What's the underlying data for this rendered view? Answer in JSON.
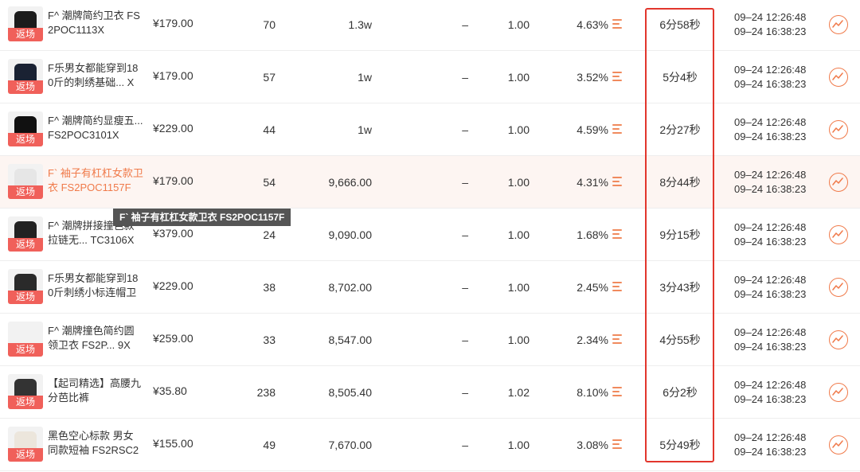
{
  "tooltip": "F` 袖子有杠杠女款卫衣 FS2POC1157F",
  "rows": [
    {
      "tag": "返场",
      "name": "F^ 潮牌简约卫衣 FS2POC1113X",
      "price": "¥179.00",
      "c1": "70",
      "c2": "1.3w",
      "c3": "–",
      "c4": "1.00",
      "c5": "4.63%",
      "duration": "6分58秒",
      "time1": "09–24  12:26:48",
      "time2": "09–24  16:38:23",
      "shirt": "#1c1c1c"
    },
    {
      "tag": "返场",
      "name": "F乐男女都能穿到180斤的刺绣基础... X",
      "price": "¥179.00",
      "c1": "57",
      "c2": "1w",
      "c3": "–",
      "c4": "1.00",
      "c5": "3.52%",
      "duration": "5分4秒",
      "time1": "09–24  12:26:48",
      "time2": "09–24  16:38:23",
      "shirt": "#1a2233"
    },
    {
      "tag": "返场",
      "name": "F^ 潮牌简约显瘦五... FS2POC3101X",
      "price": "¥229.00",
      "c1": "44",
      "c2": "1w",
      "c3": "–",
      "c4": "1.00",
      "c5": "4.59%",
      "duration": "2分27秒",
      "time1": "09–24  12:26:48",
      "time2": "09–24  16:38:23",
      "shirt": "#111111"
    },
    {
      "tag": "返场",
      "name": "F` 袖子有杠杠女款卫衣 FS2POC1157F",
      "price": "¥179.00",
      "c1": "54",
      "c2": "9,666.00",
      "c3": "–",
      "c4": "1.00",
      "c5": "4.31%",
      "duration": "8分44秒",
      "time1": "09–24  12:26:48",
      "time2": "09–24  16:38:23",
      "shirt": "#e6e6e6"
    },
    {
      "tag": "返场",
      "name": "F^ 潮牌拼接撞色款拉链无... TC3106X",
      "price": "¥379.00",
      "c1": "24",
      "c2": "9,090.00",
      "c3": "–",
      "c4": "1.00",
      "c5": "1.68%",
      "duration": "9分15秒",
      "time1": "09–24  12:26:48",
      "time2": "09–24  16:38:23",
      "shirt": "#222222"
    },
    {
      "tag": "返场",
      "name": "F乐男女都能穿到180斤刺绣小标连帽卫",
      "price": "¥229.00",
      "c1": "38",
      "c2": "8,702.00",
      "c3": "–",
      "c4": "1.00",
      "c5": "2.45%",
      "duration": "3分43秒",
      "time1": "09–24  12:26:48",
      "time2": "09–24  16:38:23",
      "shirt": "#2a2a2a"
    },
    {
      "tag": "返场",
      "name": "F^ 潮牌撞色简约圆领卫衣 FS2P... 9X",
      "price": "¥259.00",
      "c1": "33",
      "c2": "8,547.00",
      "c3": "–",
      "c4": "1.00",
      "c5": "2.34%",
      "duration": "4分55秒",
      "time1": "09–24  12:26:48",
      "time2": "09–24  16:38:23",
      "shirt": "#f2f2f2"
    },
    {
      "tag": "返场",
      "name": "【起司精选】高腰九分芭比裤",
      "price": "¥35.80",
      "c1": "238",
      "c2": "8,505.40",
      "c3": "–",
      "c4": "1.02",
      "c5": "8.10%",
      "duration": "6分2秒",
      "time1": "09–24  12:26:48",
      "time2": "09–24  16:38:23",
      "shirt": "#333333"
    },
    {
      "tag": "返场",
      "name": "黑色空心标款 男女同款短袖 FS2RSC2",
      "price": "¥155.00",
      "c1": "49",
      "c2": "7,670.00",
      "c3": "–",
      "c4": "1.00",
      "c5": "3.08%",
      "duration": "5分49秒",
      "time1": "09–24  12:26:48",
      "time2": "09–24  16:38:23",
      "shirt": "#ece6dc"
    }
  ]
}
